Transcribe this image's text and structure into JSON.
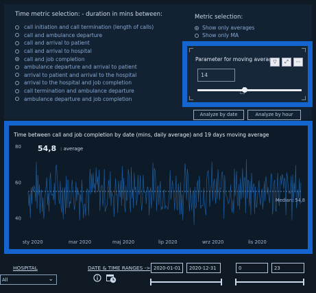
{
  "time_metric": {
    "title": "Time metric selection: - duration in mins between:",
    "options": [
      "call initiation and call termination (length of calls)",
      "call and ambulance departure",
      "call and arrival to patient",
      "call and arrival to hospital",
      "call and job completion",
      "ambulance departure and arrival to patient",
      "arrival to patient and arrival to the hospital",
      "arrival to the hospital and job completion",
      "call termination and ambulance departure",
      "ambulance departure and job completion"
    ],
    "selected_index": 4
  },
  "metric_selection": {
    "title": "Metric selection:",
    "options": [
      "Show only averages",
      "Show only MA"
    ],
    "selected_index": 0
  },
  "parameter": {
    "title": "Parameter for moving average",
    "value": "14",
    "toolbar": [
      "filter-icon",
      "focus-mode-icon",
      "more-options-icon"
    ]
  },
  "buttons": {
    "analyze_date": "Analyze by date",
    "analyze_hour": "Analyze by hour"
  },
  "chart_data": {
    "type": "line",
    "title": "Time between call and job completion by date (mins, daily average) and 19 days moving average",
    "kpi_value": "54,8",
    "kpi_label": ": average",
    "y_ticks": [
      "80",
      "60",
      "40"
    ],
    "ylim": [
      36,
      82
    ],
    "x_ticks": [
      "sty 2020",
      "mar 2020",
      "maj 2020",
      "lip 2020",
      "wrz 2020",
      "lis 2020"
    ],
    "median_label": "Median: 54,8",
    "median": 54.8,
    "grid": false,
    "series_color": "#1d5c9e"
  },
  "bottom": {
    "hospital_label": "HOSPITAL",
    "hospital_value": "All",
    "date_ranges_label": "DATE & TIME RANGES ->",
    "date_from": "2020-01-01",
    "date_to": "2020-12-31",
    "hour_from": "0",
    "hour_to": "23",
    "icons": [
      "info-icon",
      "calendar-clock-icon"
    ]
  },
  "colors": {
    "accent_border": "#1565d0",
    "background": "#0f1a24",
    "line": "#1d5c9e",
    "median_line": "#6f8fb3"
  }
}
